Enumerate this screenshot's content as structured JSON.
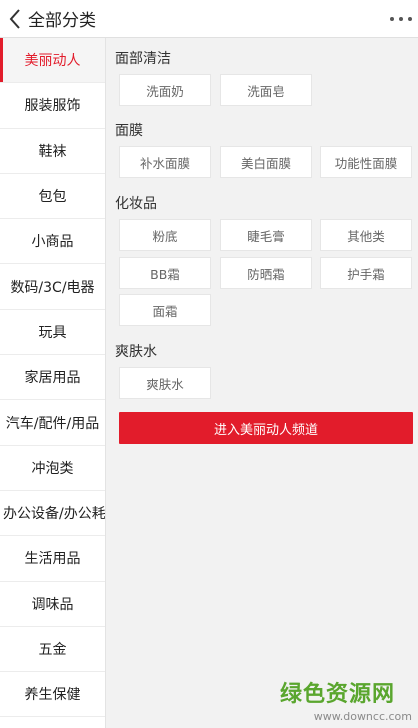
{
  "header": {
    "title": "全部分类"
  },
  "sidebar": {
    "items": [
      "美丽动人",
      "服装服饰",
      "鞋袜",
      "包包",
      "小商品",
      "数码/3C/电器",
      "玩具",
      "家居用品",
      "汽车/配件/用品",
      "冲泡类",
      "办公设备/办公耗材",
      "生活用品",
      "调味品",
      "五金",
      "养生保健"
    ],
    "active_index": 0
  },
  "sections": [
    {
      "title": "面部清洁",
      "tags": [
        "洗面奶",
        "洗面皂"
      ]
    },
    {
      "title": "面膜",
      "tags": [
        "补水面膜",
        "美白面膜",
        "功能性面膜"
      ]
    },
    {
      "title": "化妆品",
      "tags": [
        "粉底",
        "睫毛膏",
        "其他类",
        "BB霜",
        "防晒霜",
        "护手霜",
        "面霜"
      ]
    },
    {
      "title": "爽肤水",
      "tags": [
        "爽肤水"
      ]
    }
  ],
  "channel_button": "进入美丽动人频道",
  "watermark": {
    "main": "绿色资源网",
    "sub": "www.downcc.com"
  },
  "colors": {
    "accent": "#e21c2b",
    "watermark": "#5aa62e"
  },
  "icons": {
    "back": "chevron-left-icon",
    "more": "more-dots-icon"
  }
}
